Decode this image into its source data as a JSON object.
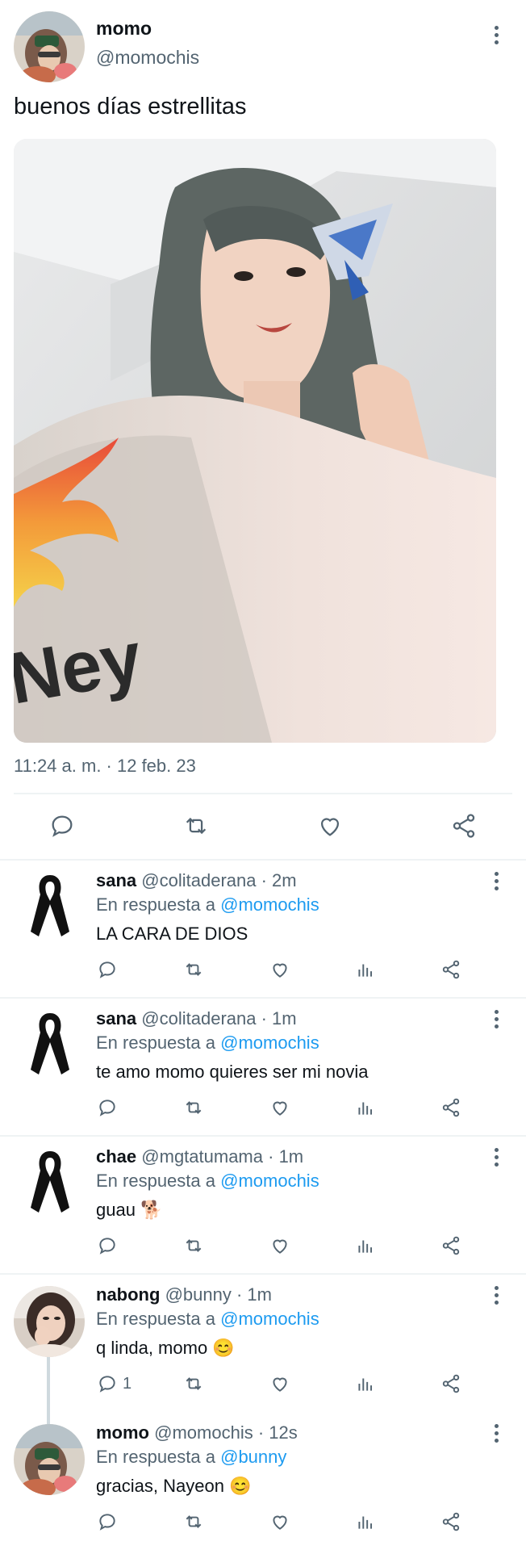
{
  "tweet": {
    "author_name": "momo",
    "author_handle": "@momochis",
    "text": "buenos días estrellitas",
    "timestamp": "11:24 a. m. · 12 feb. 23"
  },
  "replies": [
    {
      "name": "sana",
      "handle": "@colitaderana",
      "time": "· 2m",
      "reply_prefix": "En respuesta a",
      "mention": "@momochis",
      "text": "LA CARA DE DIOS",
      "avatar": "black-ribbon",
      "reply_count": ""
    },
    {
      "name": "sana",
      "handle": "@colitaderana",
      "time": "· 1m",
      "reply_prefix": "En respuesta a",
      "mention": "@momochis",
      "text": "te amo momo quieres ser mi novia",
      "avatar": "black-ribbon",
      "reply_count": ""
    },
    {
      "name": "chae",
      "handle": "@mgtatumama",
      "time": "· 1m",
      "reply_prefix": "En respuesta a",
      "mention": "@momochis",
      "text": "guau 🐕",
      "avatar": "black-ribbon",
      "reply_count": ""
    },
    {
      "name": "nabong",
      "handle": "@bunny",
      "time": "· 1m",
      "reply_prefix": "En respuesta a",
      "mention": "@momochis",
      "text": "q linda, momo 😊",
      "avatar": "photo",
      "reply_count": "1"
    },
    {
      "name": "momo",
      "handle": "@momochis",
      "time": "· 12s",
      "reply_prefix": "En respuesta a",
      "mention": "@bunny",
      "text": "gracias, Nayeon 😊",
      "avatar": "photo",
      "reply_count": ""
    }
  ],
  "icons": {
    "reply": "reply-icon",
    "retweet": "retweet-icon",
    "like": "heart-icon",
    "views": "analytics-icon",
    "share": "share-icon",
    "more": "more-vertical-icon"
  },
  "colors": {
    "text": "#0f1419",
    "secondary": "#536471",
    "accent": "#1d9bf0",
    "divider": "#eff3f4"
  }
}
